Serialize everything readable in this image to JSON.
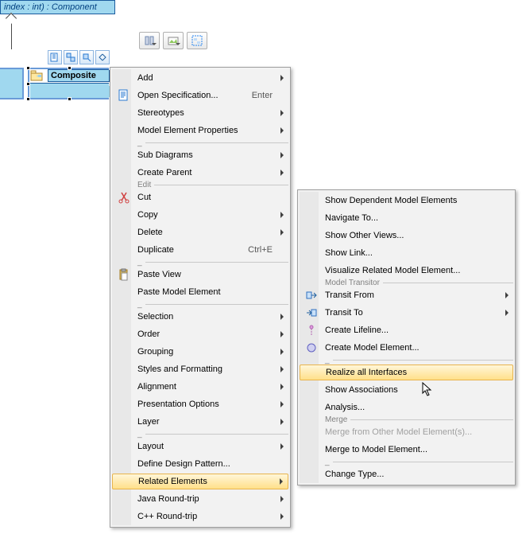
{
  "uml": {
    "top_box": "index : int) : Component",
    "composite_label": "Composite"
  },
  "menu1": {
    "items": [
      {
        "label": "Add",
        "sub": true,
        "icon": ""
      },
      {
        "label": "Open Specification...",
        "shortcut": "Enter",
        "icon": "spec"
      },
      {
        "label": "Stereotypes",
        "sub": true
      },
      {
        "label": "Model Element Properties",
        "sub": true
      },
      "__sep__",
      {
        "label": "Sub Diagrams",
        "sub": true
      },
      {
        "label": "Create Parent",
        "sub": true
      },
      "__sep_Edit__",
      {
        "label": "Cut",
        "icon": "cut"
      },
      {
        "label": "Copy",
        "sub": true
      },
      {
        "label": "Delete",
        "sub": true
      },
      {
        "label": "Duplicate",
        "shortcut": "Ctrl+E"
      },
      "__sep__",
      {
        "label": "Paste View",
        "icon": "paste"
      },
      {
        "label": "Paste Model Element"
      },
      "__sep__",
      {
        "label": "Selection",
        "sub": true
      },
      {
        "label": "Order",
        "sub": true
      },
      {
        "label": "Grouping",
        "sub": true
      },
      {
        "label": "Styles and Formatting",
        "sub": true
      },
      {
        "label": "Alignment",
        "sub": true
      },
      {
        "label": "Presentation Options",
        "sub": true
      },
      {
        "label": "Layer",
        "sub": true
      },
      "__sep__",
      {
        "label": "Layout",
        "sub": true
      },
      {
        "label": "Define Design Pattern..."
      },
      {
        "label": "Related Elements",
        "sub": true,
        "highlighted": true
      },
      {
        "label": "Java Round-trip",
        "sub": true
      },
      {
        "label": "C++ Round-trip",
        "sub": true
      }
    ]
  },
  "menu2": {
    "items": [
      {
        "label": "Show Dependent Model Elements"
      },
      {
        "label": "Navigate To..."
      },
      {
        "label": "Show Other Views..."
      },
      {
        "label": "Show Link..."
      },
      {
        "label": "Visualize Related Model Element..."
      },
      "__sep_Model Transitor__",
      {
        "label": "Transit From",
        "sub": true,
        "icon": "transit-from"
      },
      {
        "label": "Transit To",
        "sub": true,
        "icon": "transit-to"
      },
      {
        "label": "Create Lifeline...",
        "icon": "lifeline"
      },
      {
        "label": "Create Model Element...",
        "icon": "model-el"
      },
      "__sep__",
      {
        "label": "Realize all Interfaces",
        "highlighted": true
      },
      {
        "label": "Show Associations"
      },
      {
        "label": "Analysis..."
      },
      "__sep_Merge__",
      {
        "label": "Merge from Other Model Element(s)...",
        "disabled": true
      },
      {
        "label": "Merge to Model Element..."
      },
      "__sep__",
      {
        "label": "Change Type..."
      }
    ]
  }
}
